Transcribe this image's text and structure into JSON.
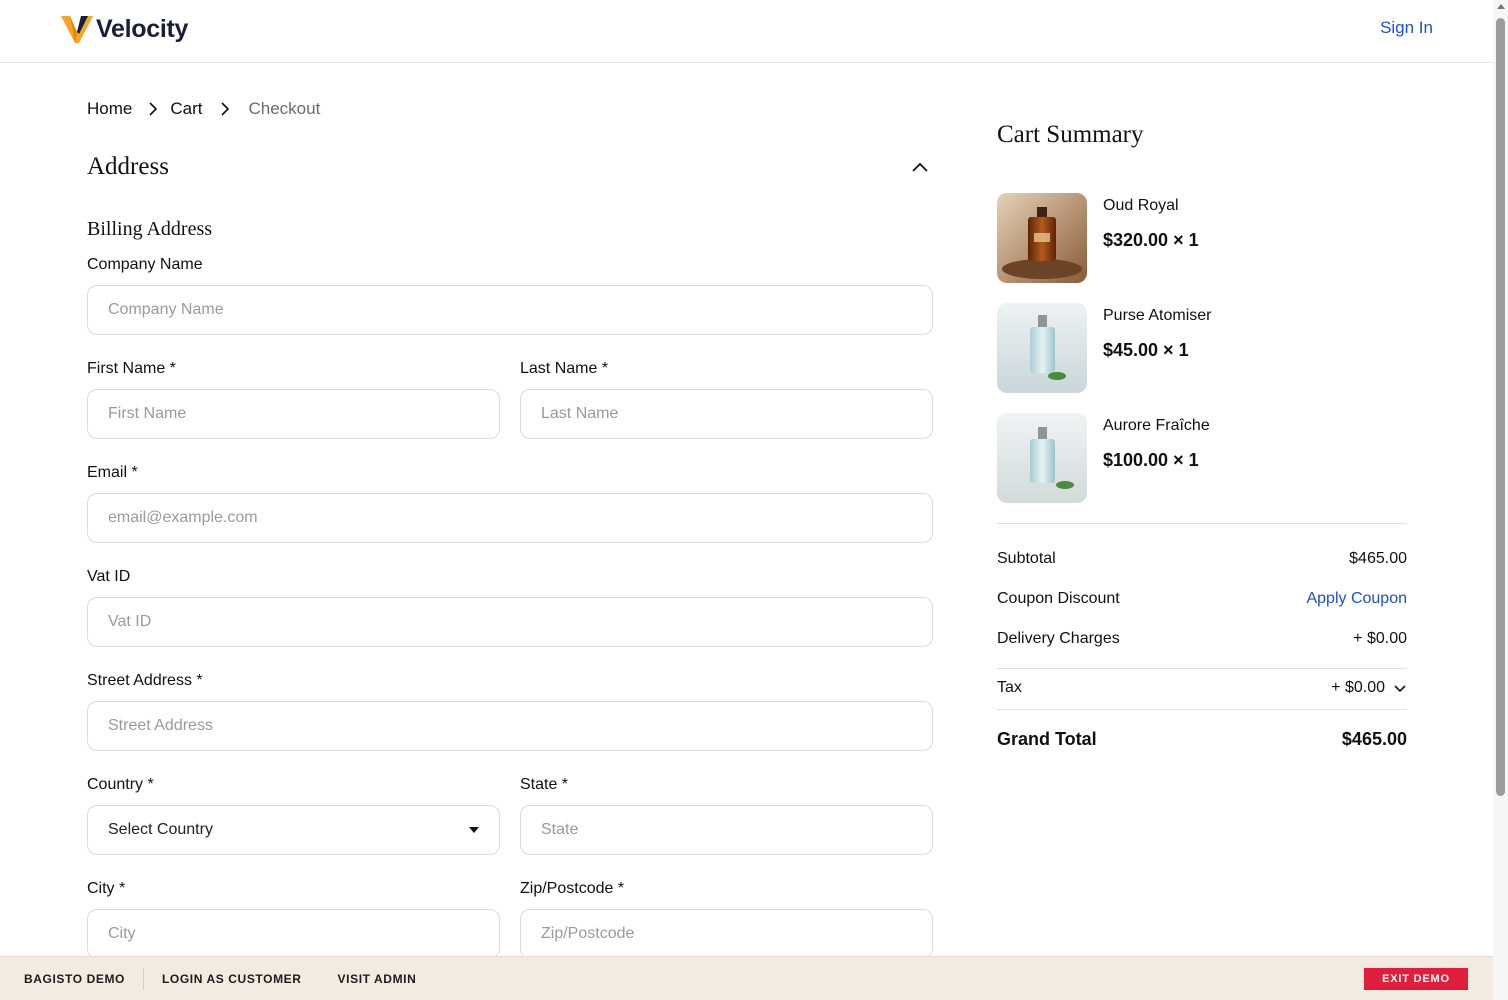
{
  "header": {
    "brand": "Velocity",
    "sign_in": "Sign In"
  },
  "breadcrumb": {
    "home": "Home",
    "cart": "Cart",
    "current": "Checkout"
  },
  "address": {
    "title": "Address",
    "billing_title": "Billing Address",
    "fields": {
      "company": {
        "label": "Company Name",
        "placeholder": "Company Name"
      },
      "first_name": {
        "label": "First Name *",
        "placeholder": "First Name"
      },
      "last_name": {
        "label": "Last Name *",
        "placeholder": "Last Name"
      },
      "email": {
        "label": "Email *",
        "placeholder": "email@example.com"
      },
      "vat": {
        "label": "Vat ID",
        "placeholder": "Vat ID"
      },
      "street": {
        "label": "Street Address *",
        "placeholder": "Street Address"
      },
      "country": {
        "label": "Country *",
        "selected": "Select Country"
      },
      "state": {
        "label": "State *",
        "placeholder": "State"
      },
      "city": {
        "label": "City *",
        "placeholder": "City"
      },
      "zip": {
        "label": "Zip/Postcode *",
        "placeholder": "Zip/Postcode"
      }
    }
  },
  "cart_summary": {
    "title": "Cart Summary",
    "items": [
      {
        "name": "Oud Royal",
        "price": "$320.00 × 1",
        "image": "amber-perfume-bottle"
      },
      {
        "name": "Purse Atomiser",
        "price": "$45.00 × 1",
        "image": "light-blue-perfume-bottle"
      },
      {
        "name": "Aurore Fraîche",
        "price": "$100.00 × 1",
        "image": "light-blue-perfume-bottle"
      }
    ],
    "subtotal_label": "Subtotal",
    "subtotal_value": "$465.00",
    "coupon_label": "Coupon Discount",
    "coupon_action": "Apply Coupon",
    "delivery_label": "Delivery Charges",
    "delivery_value": "+ $0.00",
    "tax_label": "Tax",
    "tax_value": "+ $0.00",
    "grand_total_label": "Grand Total",
    "grand_total_value": "$465.00"
  },
  "demo_bar": {
    "brand": "BAGISTO DEMO",
    "login_customer": "LOGIN AS CUSTOMER",
    "visit_admin": "VISIT ADMIN",
    "exit": "EXIT DEMO"
  },
  "colors": {
    "link": "#1a4fd1",
    "logo_orange": "#f6a623",
    "logo_navy": "#1a1d3b",
    "exit_button": "#e01e3c",
    "demo_bar_bg": "#f1ebe2"
  }
}
